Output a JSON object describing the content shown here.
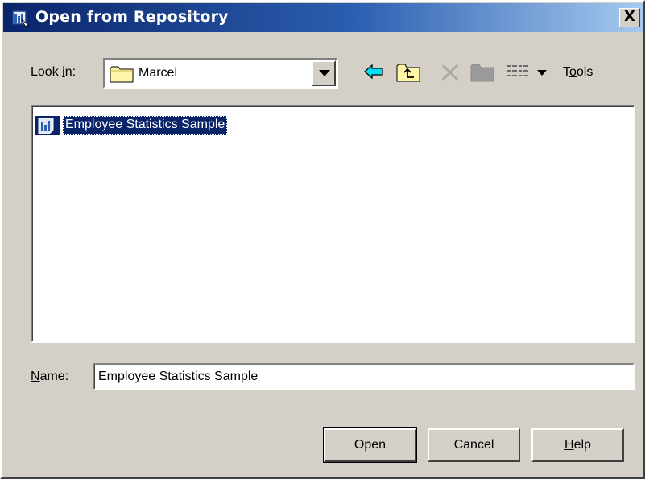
{
  "window": {
    "title": "Open from Repository",
    "close_label": "X",
    "accent": "#0a246a",
    "icons": [
      "repository-icon"
    ]
  },
  "lookin": {
    "label_prefix": "Look ",
    "label_accel": "i",
    "label_suffix": "n:",
    "value": "Marcel",
    "icon": "folder-icon"
  },
  "toolbar": {
    "icons": [
      "back-arrow-icon",
      "up-folder-icon",
      "delete-icon",
      "new-folder-icon",
      "view-menu-icon"
    ],
    "tools_prefix": "T",
    "tools_accel": "o",
    "tools_suffix": "ols"
  },
  "files": [
    {
      "name": "Employee Statistics Sample",
      "icon": "report-icon",
      "selected": true
    }
  ],
  "name_field": {
    "label_accel": "N",
    "label_suffix": "ame:",
    "value": "Employee Statistics Sample"
  },
  "buttons": {
    "open": "Open",
    "cancel": "Cancel",
    "help_accel": "H",
    "help_suffix": "elp"
  }
}
